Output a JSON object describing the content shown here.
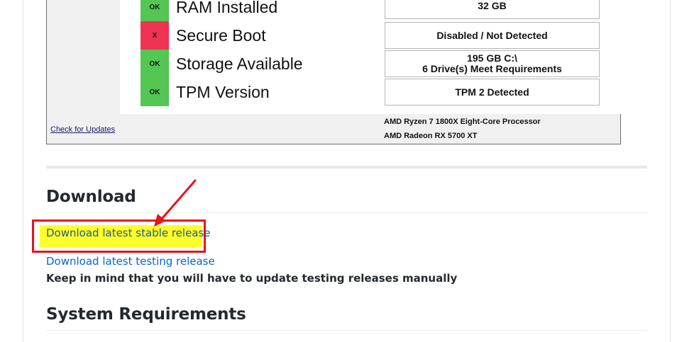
{
  "app": {
    "requirements": [
      {
        "status": "OK",
        "label": "RAM Installed",
        "value": "32 GB"
      },
      {
        "status": "X",
        "label": "Secure Boot",
        "value": "Disabled / Not Detected"
      },
      {
        "status": "OK",
        "label": "Storage Available",
        "value": "195 GB C:\\\n6 Drive(s) Meet Requirements"
      },
      {
        "status": "OK",
        "label": "TPM Version",
        "value": "TPM 2 Detected"
      }
    ],
    "check_updates": "Check for Updates",
    "cpu": "AMD Ryzen 7 1800X Eight-Core Processor",
    "gpu": "AMD Radeon RX 5700 XT"
  },
  "download": {
    "heading": "Download",
    "stable_link": "Download latest stable release",
    "testing_link": "Download latest testing release",
    "note": "Keep in mind that you will have to update testing releases manually"
  },
  "requirements_section": {
    "heading": "System Requirements"
  },
  "colors": {
    "ok": "#53c653",
    "fail": "#ee3353",
    "highlight": "#ffff2a",
    "annotation": "#e8131c",
    "link": "#0366d6"
  }
}
